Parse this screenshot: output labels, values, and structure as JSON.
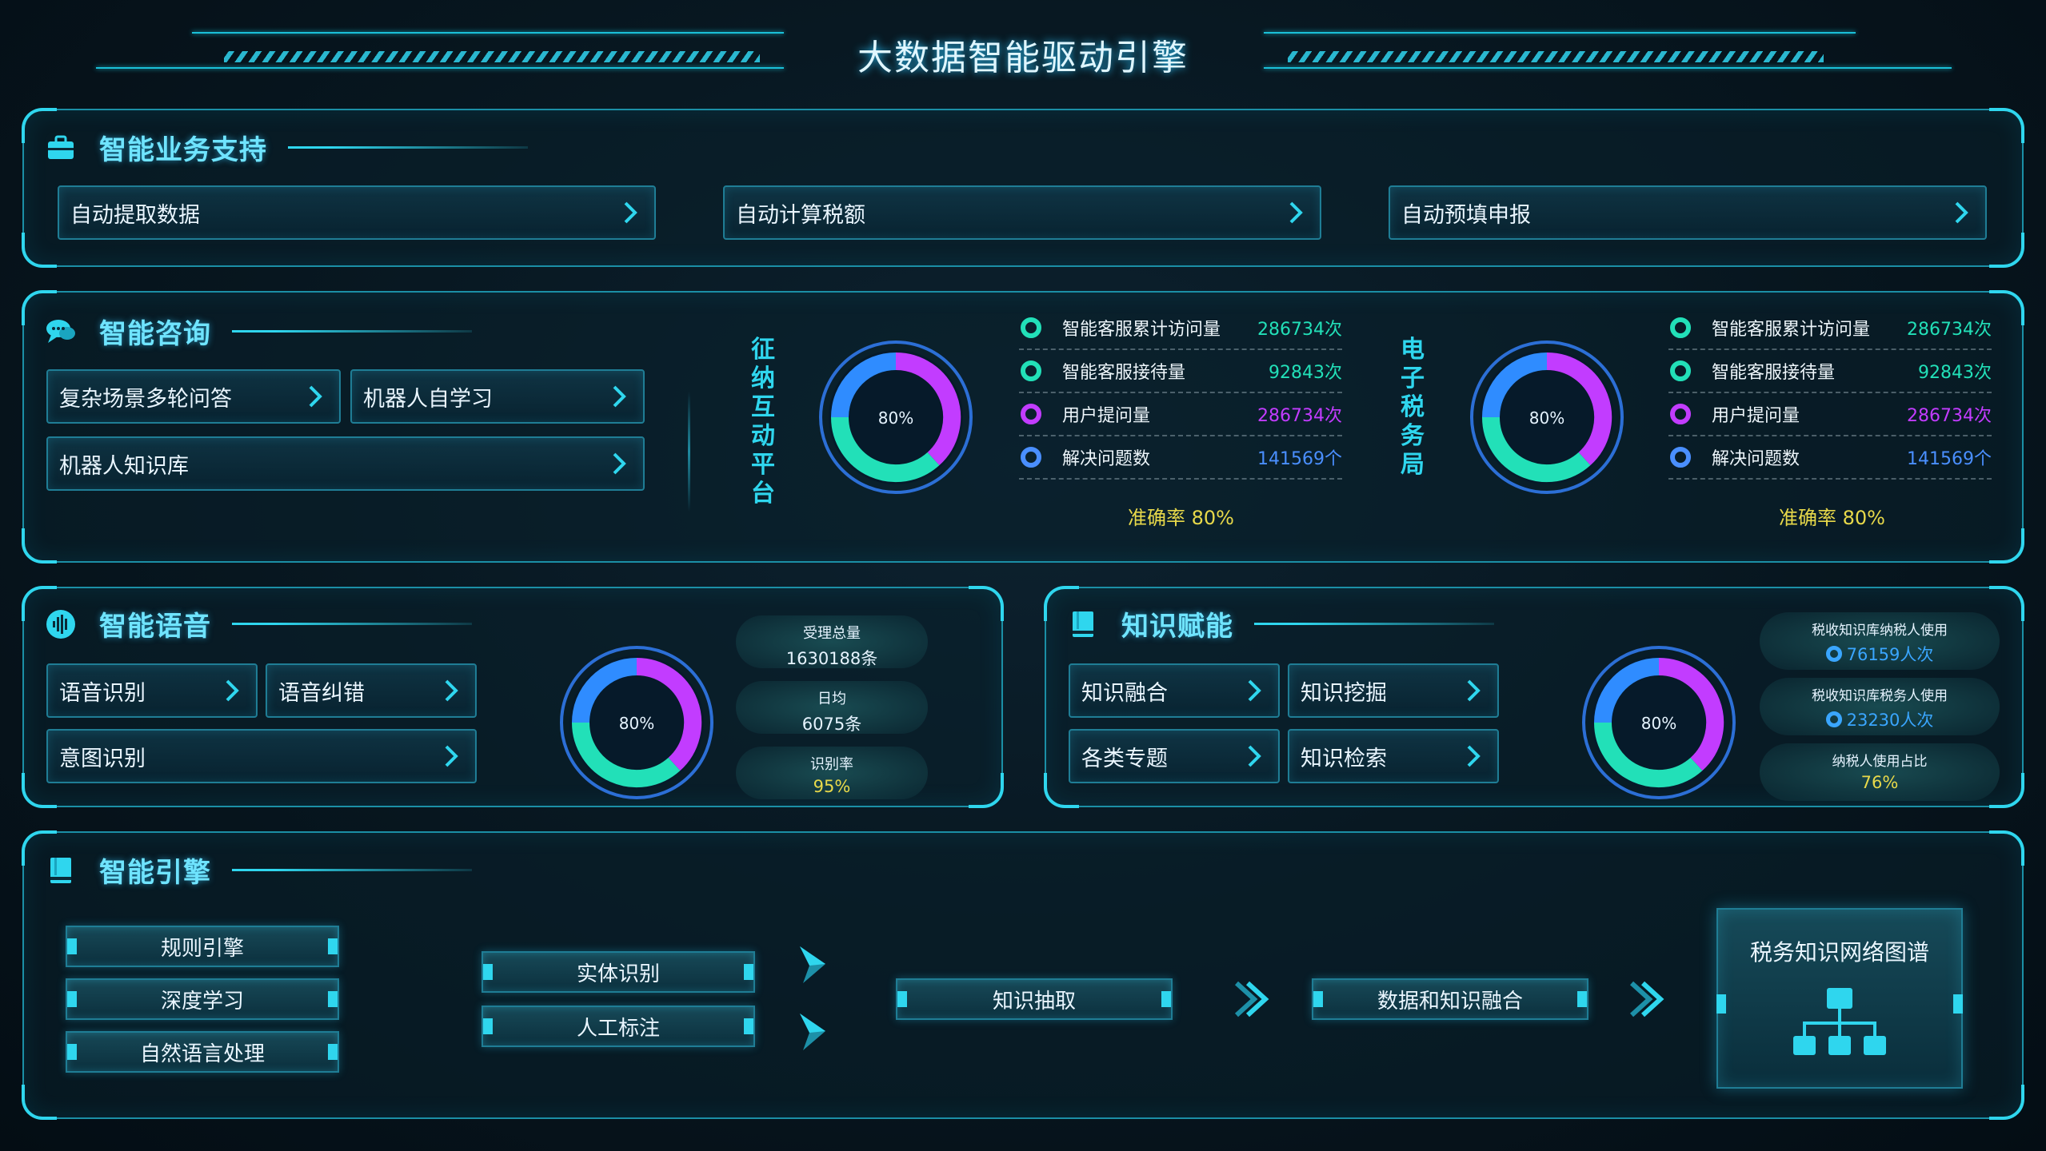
{
  "header": {
    "title": "大数据智能驱动引擎"
  },
  "business": {
    "title": "智能业务支持",
    "buttons": [
      "自动提取数据",
      "自动计算税额",
      "自动预填申报"
    ]
  },
  "consult": {
    "title": "智能咨询",
    "buttons": [
      "复杂场景多轮问答",
      "机器人自学习",
      "机器人知识库"
    ],
    "platforms": [
      {
        "label": "征纳互动平台",
        "donut_pct": "80%",
        "donut_fraction": 0.8,
        "stats": [
          {
            "label": "智能客服累计访问量",
            "value": "286734次",
            "color": "#22e0b8"
          },
          {
            "label": "智能客服接待量",
            "value": "92843次",
            "color": "#22e0b8"
          },
          {
            "label": "用户提问量",
            "value": "286734次",
            "color": "#c23cff"
          },
          {
            "label": "解决问题数",
            "value": "141569个",
            "color": "#4a8fff"
          }
        ],
        "accuracy": "准确率 80%"
      },
      {
        "label": "电子税务局",
        "donut_pct": "80%",
        "donut_fraction": 0.8,
        "stats": [
          {
            "label": "智能客服累计访问量",
            "value": "286734次",
            "color": "#22e0b8"
          },
          {
            "label": "智能客服接待量",
            "value": "92843次",
            "color": "#22e0b8"
          },
          {
            "label": "用户提问量",
            "value": "286734次",
            "color": "#c23cff"
          },
          {
            "label": "解决问题数",
            "value": "141569个",
            "color": "#4a8fff"
          }
        ],
        "accuracy": "准确率 80%"
      }
    ]
  },
  "voice": {
    "title": "智能语音",
    "buttons": [
      "语音识别",
      "语音纠错",
      "意图识别"
    ],
    "donut_pct": "80%",
    "pills": [
      {
        "label": "受理总量",
        "value": "1630188条"
      },
      {
        "label": "日均",
        "value": "6075条"
      },
      {
        "label": "识别率",
        "value": "95%"
      }
    ]
  },
  "knowledge": {
    "title": "知识赋能",
    "buttons": [
      "知识融合",
      "知识挖掘",
      "各类专题",
      "知识检索"
    ],
    "donut_pct": "80%",
    "pills": [
      {
        "label": "税收知识库纳税人使用",
        "value": "76159人次"
      },
      {
        "label": "税收知识库税务人使用",
        "value": "23230人次"
      },
      {
        "label": "纳税人使用占比",
        "value": "76%"
      }
    ]
  },
  "engine": {
    "title": "智能引擎",
    "left": [
      "规则引擎",
      "深度学习",
      "自然语言处理"
    ],
    "middle": [
      "实体识别",
      "人工标注"
    ],
    "extract": "知识抽取",
    "fusion": "数据和知识融合",
    "graph": "税务知识网络图谱"
  },
  "colors": {
    "accent": "#2fd6ee",
    "teal": "#22e0b8",
    "purple": "#c23cff",
    "blue": "#4a8fff",
    "gold": "#e8d94a"
  }
}
